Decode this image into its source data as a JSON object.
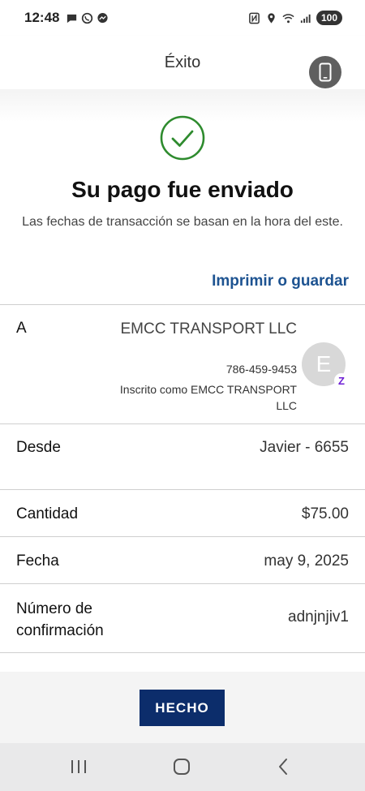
{
  "status_bar": {
    "time": "12:48",
    "battery": "100",
    "left_icons": [
      "chat-icon",
      "whatsapp-icon",
      "messenger-icon"
    ],
    "right_icons": [
      "nfc-icon",
      "location-icon",
      "wifi-icon",
      "signal-icon"
    ]
  },
  "header": {
    "title": "Éxito",
    "device_icon": "phone-icon"
  },
  "success": {
    "icon": "check-circle-icon",
    "title": "Su pago fue enviado",
    "subtitle": "Las fechas de transacción se basan en la hora del este.",
    "print_link": "Imprimir o guardar"
  },
  "details": {
    "to": {
      "label": "A",
      "name": "EMCC TRANSPORT LLC",
      "phone": "786-459-9453",
      "enrolled": "Inscrito como EMCC TRANSPORT LLC",
      "avatar_letter": "E",
      "badge": "Z"
    },
    "from": {
      "label": "Desde",
      "value": "Javier - 6655"
    },
    "amount": {
      "label": "Cantidad",
      "value": "$75.00"
    },
    "date": {
      "label": "Fecha",
      "value": "may 9, 2025"
    },
    "confirmation": {
      "label": "Número de confirmación",
      "value": "adnjnjiv1"
    }
  },
  "actions": {
    "done_label": "HECHO"
  },
  "colors": {
    "accent_blue": "#1d5391",
    "button_navy": "#0c2d6b",
    "success_green": "#2e8b2e",
    "zelle_purple": "#6d1ed4"
  }
}
